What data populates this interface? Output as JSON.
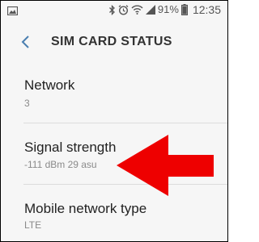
{
  "status_bar": {
    "battery_percent": "91%",
    "time": "12:35",
    "icons": [
      "image-icon",
      "bluetooth-icon",
      "alarm-icon",
      "wifi-icon",
      "signal-icon",
      "battery-icon"
    ]
  },
  "header": {
    "title": "SIM CARD STATUS",
    "back_icon": "chevron-left-icon"
  },
  "rows": [
    {
      "label": "Network",
      "value": "3"
    },
    {
      "label": "Signal strength",
      "value": "-111 dBm 29 asu"
    },
    {
      "label": "Mobile network type",
      "value": "LTE"
    }
  ],
  "colors": {
    "background": "#f6f6f6",
    "accent": "#4a7fb0",
    "arrow": "#ee0000"
  }
}
